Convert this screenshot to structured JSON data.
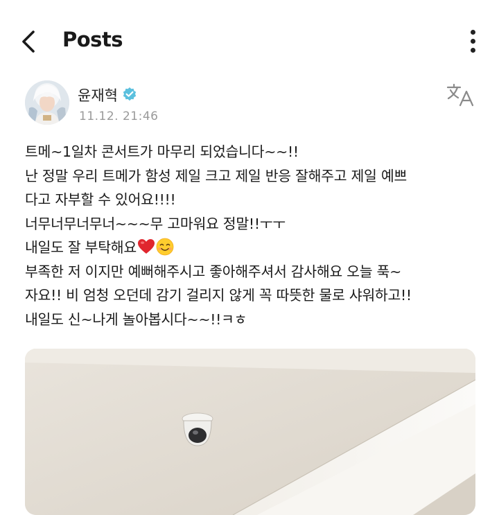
{
  "header": {
    "title": "Posts",
    "back_icon": "chevron-left-icon",
    "menu_icon": "more-vertical-icon"
  },
  "author": {
    "name": "윤재혁",
    "verified": true,
    "verified_color": "#5bc0de",
    "timestamp": "11.12. 21:46",
    "translate_icon": "translate-icon"
  },
  "post": {
    "lines": [
      "트메~1일차 콘서트가 마무리 되었습니다~~!!",
      "난 정말 우리 트메가 함성 제일 크고 제일 반응 잘해주고 제일 예쁘",
      "다고 자부할 수 있어요!!!!",
      "너무너무너무너~~~무 고마워요 정말!!ㅜㅜ",
      "내일도 잘 부탁해요",
      "부족한 저 이지만 예뻐해주시고 좋아해주셔서 감사해요 오늘 푹~",
      "자요!! 비 엄청 오던데 감기 걸리지 않게 꼭 따뜻한 물로 샤워하고!!",
      "내일도 신~나게 놀아봅시다~~!!ㅋㅎ"
    ],
    "emojis": [
      "red-heart-icon",
      "smiling-face-icon"
    ],
    "image": "photo-ceiling-with-security-camera"
  },
  "colors": {
    "background": "#ffffff",
    "text": "#1a1a1a",
    "muted": "#9a9a9a",
    "heart": "#e0262e"
  }
}
